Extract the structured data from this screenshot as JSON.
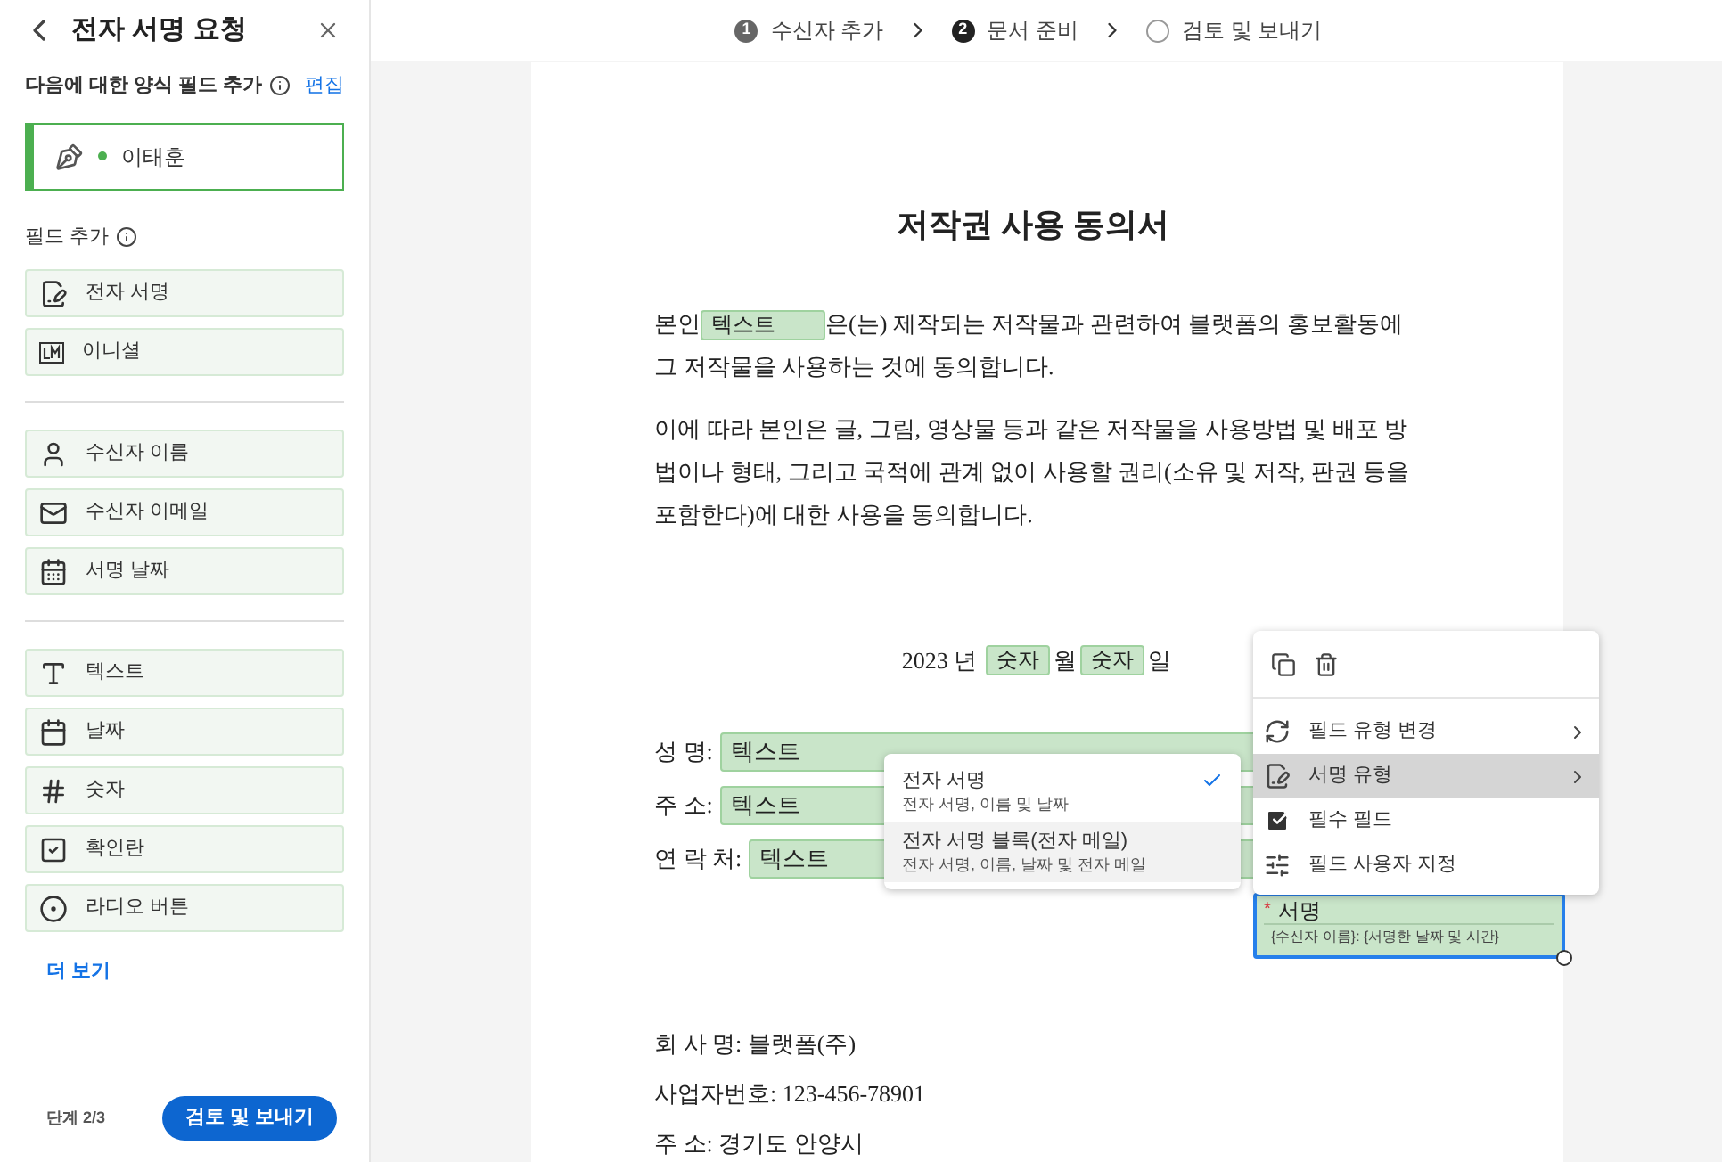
{
  "sidebar": {
    "title": "전자 서명 요청",
    "recipients_label": "다음에 대한 양식 필드 추가",
    "edit_link": "편집",
    "recipient": {
      "name": "이태훈",
      "color": "#4caf50"
    },
    "fields_label": "필드 추가",
    "field_groups": [
      [
        {
          "kind": "signature",
          "label": "전자 서명"
        },
        {
          "kind": "initials",
          "label": "이니셜"
        }
      ],
      [
        {
          "kind": "name",
          "label": "수신자 이름"
        },
        {
          "kind": "email",
          "label": "수신자 이메일"
        },
        {
          "kind": "date-signed",
          "label": "서명 날짜"
        }
      ],
      [
        {
          "kind": "text",
          "label": "텍스트"
        },
        {
          "kind": "date",
          "label": "날짜"
        },
        {
          "kind": "number",
          "label": "숫자"
        },
        {
          "kind": "checkbox",
          "label": "확인란"
        },
        {
          "kind": "radio",
          "label": "라디오 버튼"
        }
      ]
    ],
    "more_link": "더 보기",
    "step": "단계 2/3",
    "primary_button": "검토 및 보내기"
  },
  "stepper": [
    {
      "number": "1",
      "label": "수신자 추가",
      "done": true,
      "selected": false
    },
    {
      "number": "2",
      "label": "문서 준비",
      "selected": true
    },
    {
      "label": "검토 및 보내기",
      "done": false,
      "selected": false
    }
  ],
  "document": {
    "title": "저작권 사용 동의서",
    "paragraph_1": {
      "before": "본인",
      "field": "텍스트",
      "after": "은(는) 제작되는 저작물과 관련하여 블랫폼의 홍보활동에 그 저작물을 사용하는 것에 동의합니다."
    },
    "paragraph_2": "이에 따라 본인은 글, 그림, 영상물 등과 같은 저작물을 사용방법 및 배포 방법이나 형태, 그리고 국적에 관계 없이 사용할 권리(소유 및 저작, 판권 등을 포함한다)에 대한 사용을 동의합니다.",
    "date_line": {
      "year": "2023 년",
      "month_field": "숫자",
      "month": "월",
      "day_field": "숫자",
      "day": "일"
    },
    "form_rows": [
      {
        "label": "성 명:",
        "field": "텍스트"
      },
      {
        "label": "주 소:",
        "field": "텍스트"
      },
      {
        "label": "연 락 처:",
        "field": "텍스트"
      }
    ],
    "footer_lines": [
      "회 사 명: 블랫폼(주)",
      "사업자번호: 123-456-78901",
      "주 소: 경기도 안양시"
    ],
    "signature_field": {
      "required_mark": "*",
      "label": "서명",
      "hint": "{수신자 이름}: {서명한 날짜 및 시간}",
      "selected": true
    }
  },
  "context_menu": {
    "items": [
      {
        "kind": "change-type",
        "label": "필드 유형 변경",
        "highlighted": false
      },
      {
        "kind": "signature-type",
        "label": "서명 유형",
        "highlighted": true
      },
      {
        "kind": "checkbox",
        "label": "필수 필드",
        "checked": true,
        "highlighted": false
      },
      {
        "kind": "customize",
        "label": "필드 사용자 지정",
        "highlighted": false
      }
    ]
  },
  "submenu": {
    "options": [
      {
        "title": "전자 서명",
        "description": "전자 서명, 이름 및 날짜",
        "selected": true,
        "highlighted": false
      },
      {
        "title": "전자 서명 블록(전자 메일)",
        "description": "전자 서명, 이름, 날짜 및 전자 메일",
        "selected": false,
        "highlighted": true
      }
    ]
  }
}
